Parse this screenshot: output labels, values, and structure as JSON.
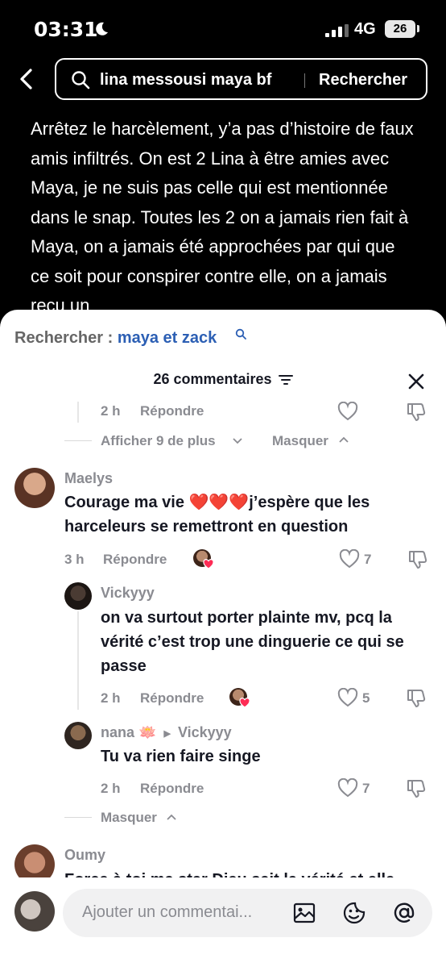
{
  "status_bar": {
    "time": "03:31",
    "network": "4G",
    "battery": "26"
  },
  "search": {
    "query": "lina messousi maya bf",
    "button": "Rechercher"
  },
  "caption": "Arrêtez le harcèlement, y’a pas d’histoire de faux amis infiltrés. On est 2 Lina à être amies avec Maya, je ne suis pas celle qui est mentionnée dans le snap. Toutes les 2 on a jamais rien fait à Maya, on a jamais été approchées par qui que ce soit pour conspirer contre elle, on a jamais reçu un",
  "sheet": {
    "suggest_prefix": "Rechercher :",
    "suggest_term": "maya et zack",
    "comment_count": "26 commentaires"
  },
  "top_reply": {
    "time": "2 h",
    "reply": "Répondre"
  },
  "show_more": {
    "label": "Afficher 9 de plus",
    "hide": "Masquer"
  },
  "comments": [
    {
      "user": "Maelys",
      "text": "Courage ma vie ❤️❤️❤️j’espère que les harceleurs se remettront en question",
      "time": "3 h",
      "reply": "Répondre",
      "likes": "7"
    }
  ],
  "replies": [
    {
      "user": "Vickyyy",
      "text": "on va surtout porter plainte mv, pcq la vérité c’est trop une dinguerie ce qui se passe",
      "time": "2 h",
      "reply": "Répondre",
      "likes": "5"
    },
    {
      "user": "nana 🪷",
      "reply_to": "Vickyyy",
      "text": "Tu va rien faire singe",
      "time": "2 h",
      "reply": "Répondre",
      "likes": "7"
    }
  ],
  "hide_replies": "Masquer",
  "last_comment": {
    "user": "Oumy",
    "text": "Force à toi ma star Dieu sait la vérité et elle"
  },
  "input": {
    "placeholder": "Ajouter un commentai..."
  },
  "colors": {
    "accent_link": "#2c5fb4",
    "heart_red": "#e0242f",
    "muted": "#8a8b91"
  }
}
